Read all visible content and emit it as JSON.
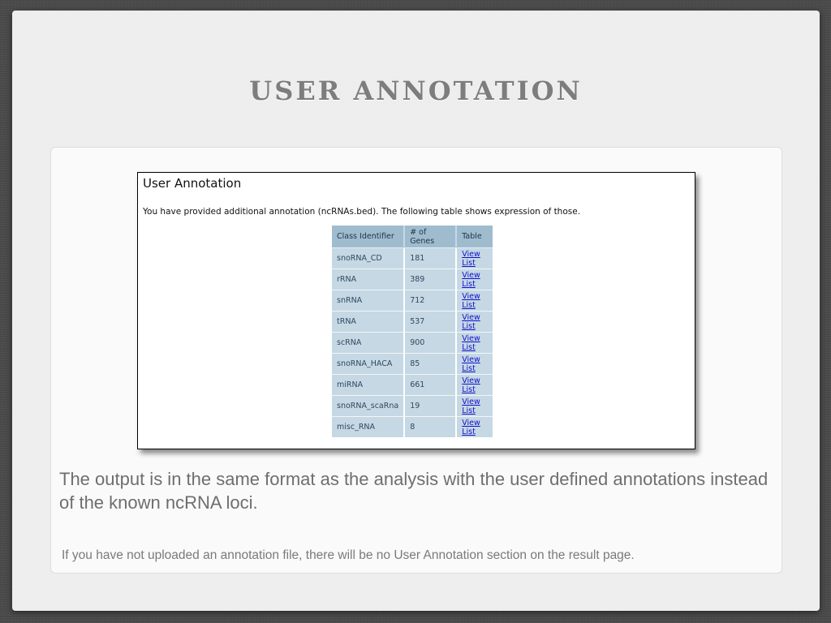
{
  "slide": {
    "title": "USER ANNOTATION",
    "body_text": "The output is in the same format as the analysis with the user defined annotations instead of the known ncRNA loci.",
    "footnote": "If you have not uploaded an annotation file, there will be no User Annotation section on the result page."
  },
  "screenshot": {
    "heading": "User Annotation",
    "description": "You have provided additional annotation (ncRNAs.bed). The following table shows expression of those.",
    "table": {
      "headers": [
        "Class Identifier",
        "# of Genes",
        "Table"
      ],
      "rows": [
        {
          "class": "snoRNA_CD",
          "genes": "181",
          "link": "View List"
        },
        {
          "class": "rRNA",
          "genes": "389",
          "link": "View List"
        },
        {
          "class": "snRNA",
          "genes": "712",
          "link": "View List"
        },
        {
          "class": "tRNA",
          "genes": "537",
          "link": "View List"
        },
        {
          "class": "scRNA",
          "genes": "900",
          "link": "View List"
        },
        {
          "class": "snoRNA_HACA",
          "genes": "85",
          "link": "View List"
        },
        {
          "class": "miRNA",
          "genes": "661",
          "link": "View List"
        },
        {
          "class": "snoRNA_scaRna",
          "genes": "19",
          "link": "View List"
        },
        {
          "class": "misc_RNA",
          "genes": "8",
          "link": "View List"
        }
      ]
    }
  },
  "colors": {
    "title": "#7d7d7d",
    "table_header": "#9fbccf",
    "table_cell": "#c5d8e4",
    "link": "#1010cc"
  }
}
